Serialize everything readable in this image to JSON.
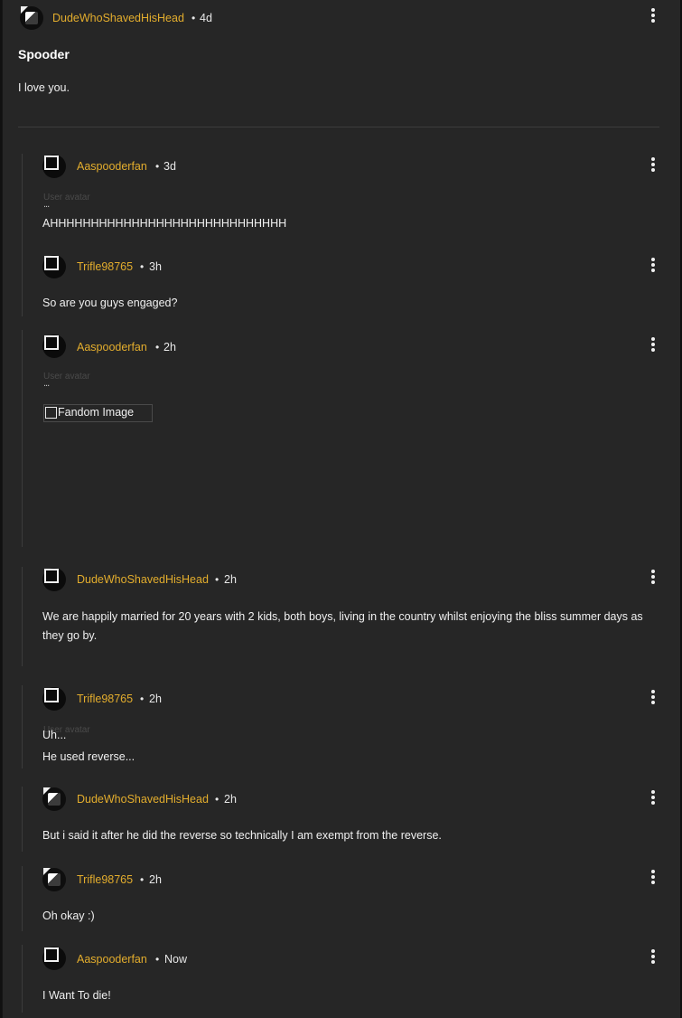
{
  "post": {
    "author": "DudeWhoShavedHisHead",
    "time": "4d",
    "title": "Spooder",
    "body": "I love you."
  },
  "avatar_alt": "User avatar",
  "separator": "•",
  "replies": [
    {
      "author": "Aaspooderfan",
      "time": "3d",
      "ellipsis": "...",
      "body": "AHHHHHHHHHHHHHHHHHHHHHHHHHHHHH"
    },
    {
      "author": "Trifle98765",
      "time": "3h",
      "body": "So are you guys engaged?"
    },
    {
      "author": "Aaspooderfan",
      "time": "2h",
      "ellipsis": "...",
      "image_alt": "Fandom Image"
    },
    {
      "author": "DudeWhoShavedHisHead",
      "time": "2h",
      "body": "We are happily married for 20 years with 2 kids, both boys, living in the country whilst enjoying the bliss summer days as they go by."
    },
    {
      "author": "Trifle98765",
      "time": "2h",
      "body_line1": "Uh...",
      "body_line2": "He used reverse..."
    },
    {
      "author": "DudeWhoShavedHisHead",
      "time": "2h",
      "body": "But i said it after he did the reverse so technically I am exempt from the reverse."
    },
    {
      "author": "Trifle98765",
      "time": "2h",
      "body": "Oh okay :)"
    },
    {
      "author": "Aaspooderfan",
      "time": "Now",
      "body": "I Want To die!"
    }
  ]
}
